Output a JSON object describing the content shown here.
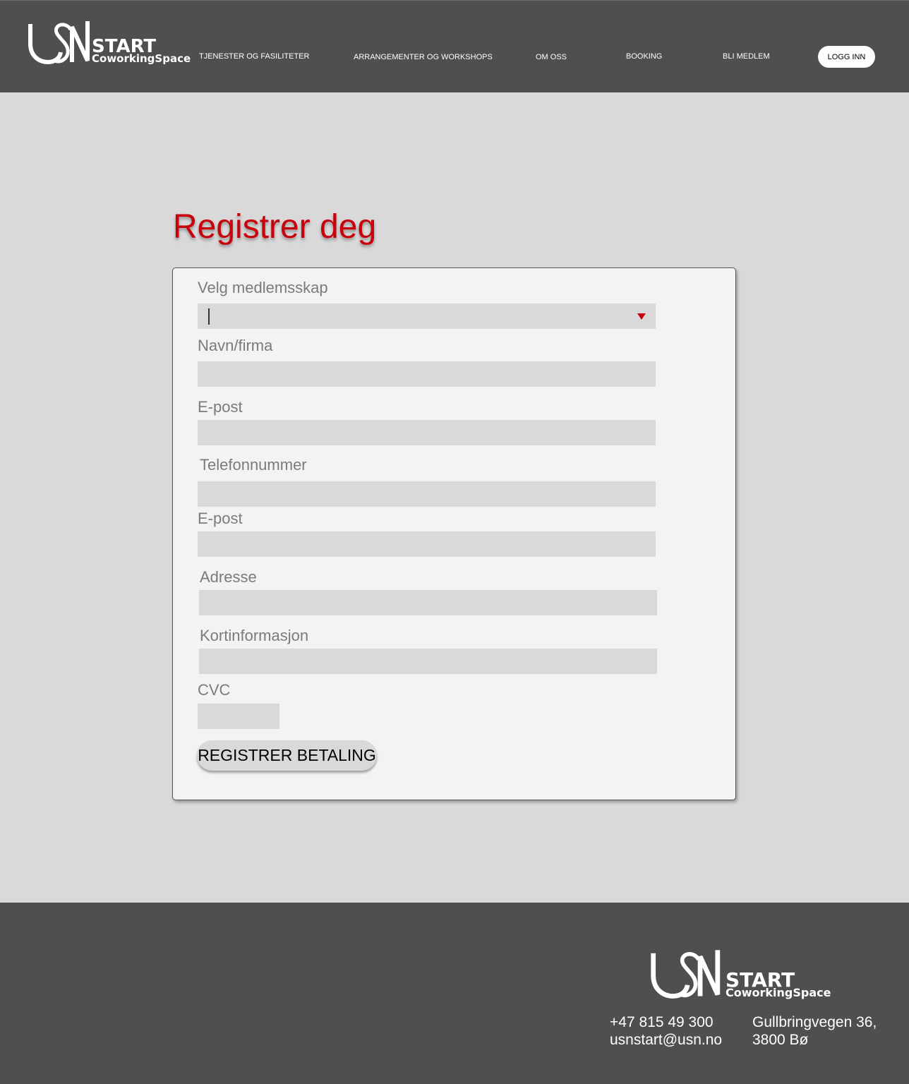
{
  "header": {
    "logo": {
      "main": "USN",
      "start": "START",
      "sub": "CoworkingSpace"
    },
    "nav": [
      {
        "label": "TJENESTER OG FASILITETER"
      },
      {
        "label": "ARRANGEMENTER OG WORKSHOPS"
      },
      {
        "label": "OM OSS"
      },
      {
        "label": "BOOKING"
      },
      {
        "label": "BLI MEDLEM"
      }
    ],
    "login_label": "LOGG INN"
  },
  "main": {
    "title": "Registrer deg",
    "form": {
      "membership_label": "Velg medlemsskap",
      "membership_value": "",
      "name_label": "Navn/firma",
      "email_label": "E-post",
      "phone_label": "Telefonnummer",
      "email2_label": "E-post",
      "address_label": "Adresse",
      "card_label": "Kortinformasjon",
      "cvc_label": "CVC",
      "submit_label": "REGISTRER BETALING"
    }
  },
  "footer": {
    "logo": {
      "main": "USN",
      "start": "START",
      "sub": "CoworkingSpace"
    },
    "phone": "+47 815 49 300",
    "email": "usnstart@usn.no",
    "address_line1": "Gullbringvegen 36,",
    "address_line2": "3800 Bø"
  },
  "colors": {
    "header_bg": "#4f4f4f",
    "page_bg": "#d9d9d9",
    "title_red": "#c8000b",
    "card_bg": "#f3f3f3",
    "input_bg": "#d9d9d9"
  }
}
